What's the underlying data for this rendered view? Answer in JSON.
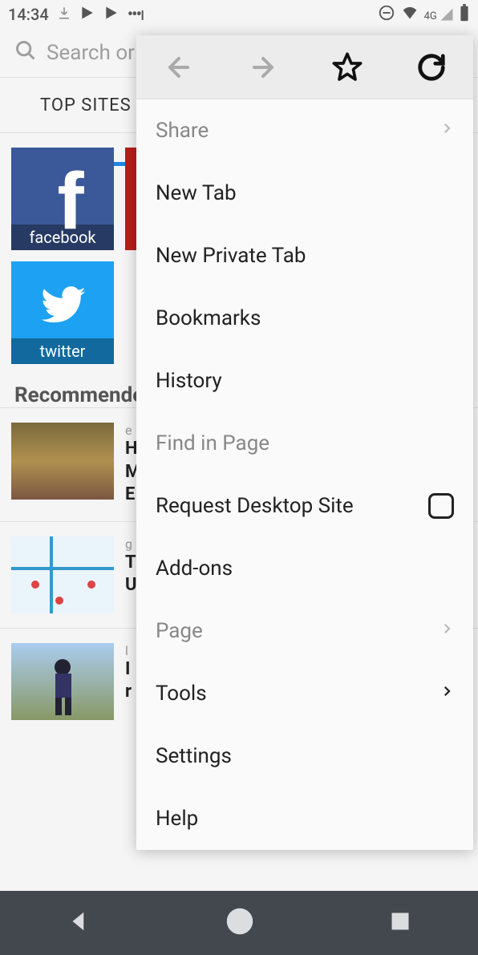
{
  "status": {
    "time": "14:34",
    "indicators": {
      "network": "4G"
    }
  },
  "search": {
    "placeholder": "Search or enter address"
  },
  "tabs": {
    "top_sites": "TOP SITES"
  },
  "sites": [
    {
      "label": "facebook"
    },
    {
      "label": ""
    },
    {
      "label": "twitter"
    }
  ],
  "sections": {
    "recommended": "Recommended by Pocket"
  },
  "articles": [
    {
      "source": "e",
      "title": "H\nM\nE"
    },
    {
      "source": "g",
      "title": "T\nU"
    },
    {
      "source": "l",
      "title": "I\nr"
    }
  ],
  "menu": {
    "share": "Share",
    "new_tab": "New Tab",
    "new_private_tab": "New Private Tab",
    "bookmarks": "Bookmarks",
    "history": "History",
    "find_in_page": "Find in Page",
    "request_desktop": "Request Desktop Site",
    "addons": "Add-ons",
    "page": "Page",
    "tools": "Tools",
    "settings": "Settings",
    "help": "Help"
  }
}
